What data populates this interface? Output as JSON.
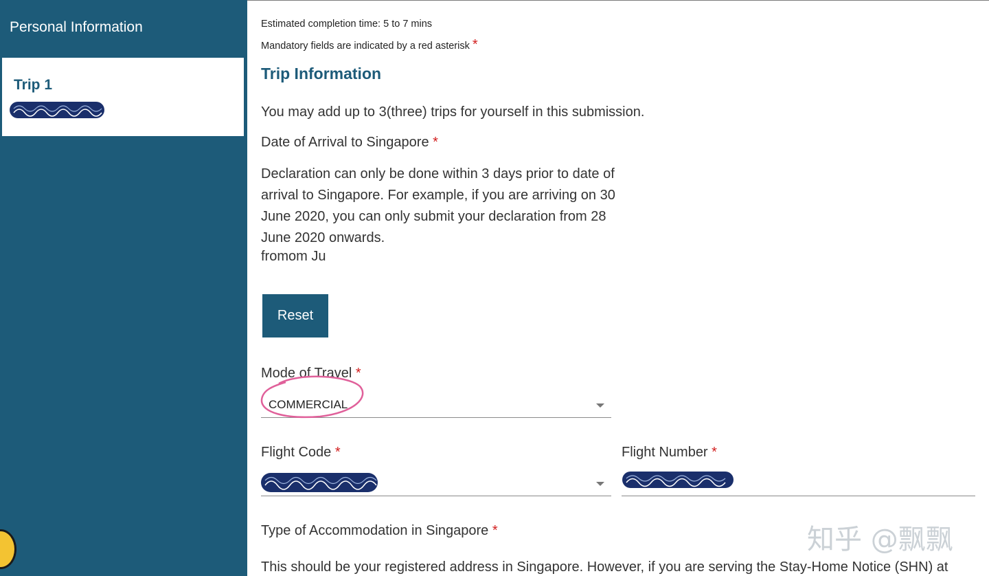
{
  "sidebar": {
    "heading": "Personal Information",
    "trip_label": "Trip 1"
  },
  "main": {
    "estimated_time": "Estimated completion time: 5 to 7 mins",
    "mandatory_note": "Mandatory fields are indicated by a red asterisk",
    "asterisk": "*",
    "section_title": "Trip Information",
    "trips_note": "You may add up to 3(three) trips for yourself in this submission.",
    "arrival_label": "Date of Arrival to Singapore",
    "arrival_help": "Declaration can only be done within 3 days prior to date of arrival to Singapore. For example, if you are arriving on 30 June 2020, you can only submit your declaration from 28 June 2020 onwards.",
    "arrival_overlap": "fromom Ju",
    "reset_label": "Reset",
    "mode_label": "Mode of Travel",
    "mode_value": "COMMERCIAL",
    "flight_code_label": "Flight Code",
    "flight_number_label": "Flight Number",
    "accommodation_label": "Type of Accommodation in Singapore",
    "accommodation_help": "This should be your registered address in Singapore. However, if you are serving the Stay-Home Notice (SHN) at"
  },
  "watermark": "知乎 @飘飘",
  "colors": {
    "brand": "#1d5b79",
    "asterisk": "#d21f1f",
    "annotation": "#e0609a"
  }
}
